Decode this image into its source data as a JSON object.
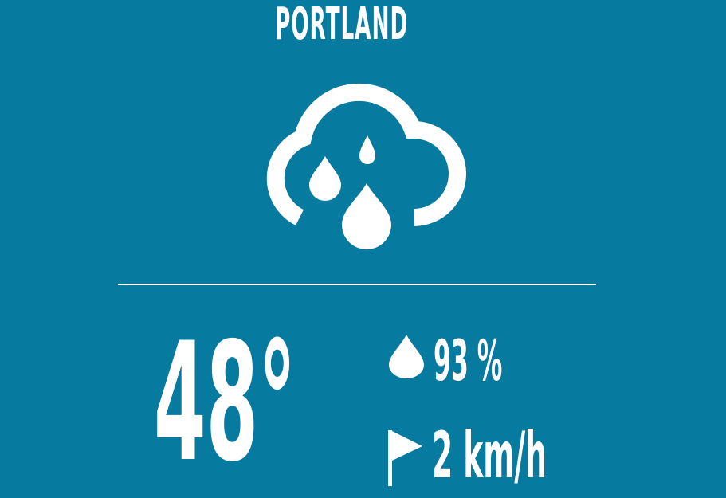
{
  "location": {
    "city": "PORTLAND"
  },
  "current": {
    "condition_icon": "rain-cloud-icon",
    "temperature": "48°",
    "humidity": {
      "icon": "droplet-icon",
      "value": "93 %"
    },
    "wind": {
      "icon": "flag-icon",
      "value": "2 km/h"
    }
  },
  "colors": {
    "background": "#077a9f",
    "foreground": "#ffffff"
  }
}
